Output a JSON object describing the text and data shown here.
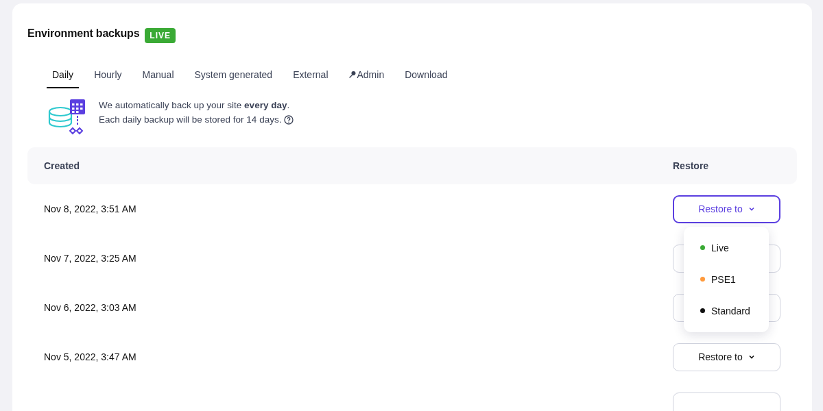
{
  "title": "Environment backups",
  "status_badge": "LIVE",
  "tabs": [
    {
      "label": "Daily",
      "selected": true,
      "icon": false
    },
    {
      "label": "Hourly",
      "selected": false,
      "icon": false
    },
    {
      "label": "Manual",
      "selected": false,
      "icon": false
    },
    {
      "label": "System generated",
      "selected": false,
      "icon": false
    },
    {
      "label": "External",
      "selected": false,
      "icon": false
    },
    {
      "label": "Admin",
      "selected": false,
      "icon": true
    },
    {
      "label": "Download",
      "selected": false,
      "icon": false
    }
  ],
  "info": {
    "line_1": "We automatically back up your site **every day**.",
    "line_2": "Each daily backup will be stored for 14 days."
  },
  "table": {
    "columns": [
      "Created",
      "Restore"
    ],
    "rows": [
      {
        "created": "Nov 8, 2022, 3:51 AM",
        "button_label": "Restore to",
        "open": true
      },
      {
        "created": "Nov 7, 2022, 3:25 AM",
        "open": false
      },
      {
        "created": "Nov 6, 2022, 3:03 AM",
        "open": false
      },
      {
        "created": "Nov 5, 2022, 3:47 AM",
        "button_label": "Restore to",
        "open": false
      },
      {
        "open": false
      }
    ]
  },
  "restore_menu": [
    {
      "label": "Live",
      "color": "#3aaa35"
    },
    {
      "label": "PSE1",
      "color": "#ff9a3c"
    },
    {
      "label": "Standard",
      "color": "#111111"
    }
  ]
}
